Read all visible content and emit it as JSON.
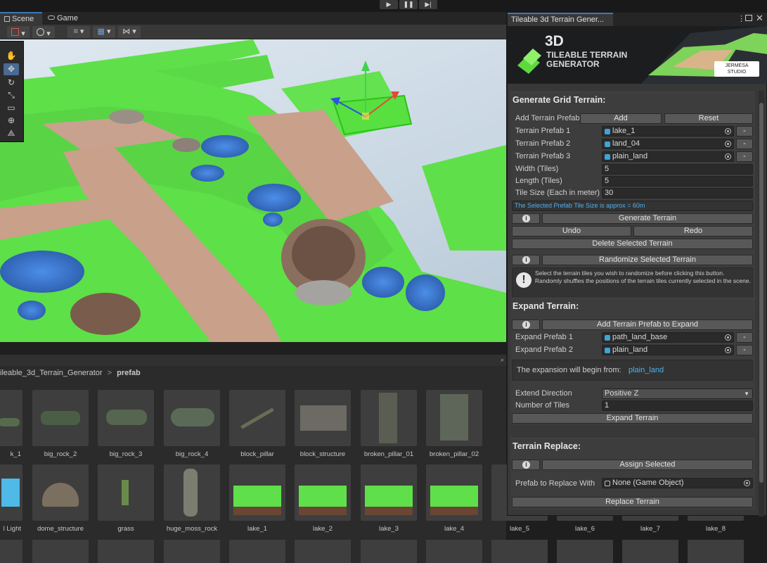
{
  "toolbar": {
    "play_icon": "play-icon",
    "pause_icon": "pause-icon",
    "step_icon": "step-icon",
    "play_glyph": "▶",
    "pause_glyph": "❚❚",
    "step_glyph": "▶|"
  },
  "tabs": [
    {
      "label": "Scene",
      "icon": "cube-grid-icon"
    },
    {
      "label": "Game",
      "icon": "gamepad-icon"
    }
  ],
  "scene_tools": [
    "hand-tool-icon",
    "move-tool-icon",
    "rotate-tool-icon",
    "scale-tool-icon",
    "rect-tool-icon",
    "transform-tool-icon",
    "custom-tool-icon"
  ],
  "project": {
    "breadcrumb": [
      "ileable_3d_Terrain_Generator",
      "prefab"
    ],
    "breadcrumb_sep": ">",
    "row1": [
      "k_1",
      "big_rock_2",
      "big_rock_3",
      "big_rock_4",
      "block_pillar",
      "block_structure",
      "broken_pillar_01",
      "broken_pillar_02"
    ],
    "row2": [
      "l Light",
      "dome_structure",
      "grass",
      "huge_moss_rock",
      "lake_1",
      "lake_2",
      "lake_3",
      "lake_4",
      "lake_5",
      "lake_6",
      "lake_7",
      "lake_8"
    ]
  },
  "window": {
    "title": "Tileable 3d Terrain Gener...",
    "banner": {
      "big": "3D",
      "line1a": "TILEABLE",
      "line1b": "TERRAIN",
      "line2": "GENERATOR",
      "studio1": "JERMESA",
      "studio2": "STUDIO"
    },
    "grid": {
      "heading": "Generate Grid Terrain:",
      "add_label": "Add Terrain Prefab:",
      "add_btn": "Add",
      "reset_btn": "Reset",
      "prefabs": [
        {
          "label": "Terrain Prefab 1",
          "value": "lake_1"
        },
        {
          "label": "Terrain Prefab 2",
          "value": "land_04"
        },
        {
          "label": "Terrain Prefab 3",
          "value": "plain_land"
        }
      ],
      "remove_btn": "-",
      "width_label": "Width (Tiles)",
      "width_value": "5",
      "length_label": "Length (Tiles)",
      "length_value": "5",
      "tile_label": "Tile Size (Each in meter)",
      "tile_value": "30",
      "hint": "The Selected Prefab Tile Size is approx = 60m",
      "info_glyph": "i",
      "generate_btn": "Generate Terrain",
      "undo_btn": "Undo",
      "redo_btn": "Redo",
      "delete_btn": "Delete Selected Terrain",
      "randomize_btn": "Randomize Selected Terrain",
      "warn_glyph": "!",
      "randomize_help": "Select the terrain tiles you wish to randomize before clicking this button. Randomly shuffles the positions of the terrain tiles currently selected in the scene."
    },
    "expand": {
      "heading": "Expand Terrain:",
      "add_btn": "Add Terrain Prefab to Expand",
      "prefabs": [
        {
          "label": "Expand Prefab 1",
          "value": "path_land_base"
        },
        {
          "label": "Expand Prefab 2",
          "value": "plain_land"
        }
      ],
      "begin_label": "The expansion will begin from:",
      "begin_value": "plain_land",
      "direction_label": "Extend Direction",
      "direction_value": "Positive Z",
      "tiles_label": "Number of Tiles",
      "tiles_value": "1",
      "expand_btn": "Expand Terrain"
    },
    "replace": {
      "heading": "Terrain Replace:",
      "assign_btn": "Assign Selected",
      "prefab_label": "Prefab to Replace With",
      "prefab_value": "None (Game Object)",
      "replace_btn": "Replace Terrain"
    }
  },
  "colors": {
    "accent": "#3a79bb",
    "link": "#4fb0f0",
    "grass": "#5fe04a",
    "path": "#c9a08a",
    "water": "#3d7ad6"
  }
}
